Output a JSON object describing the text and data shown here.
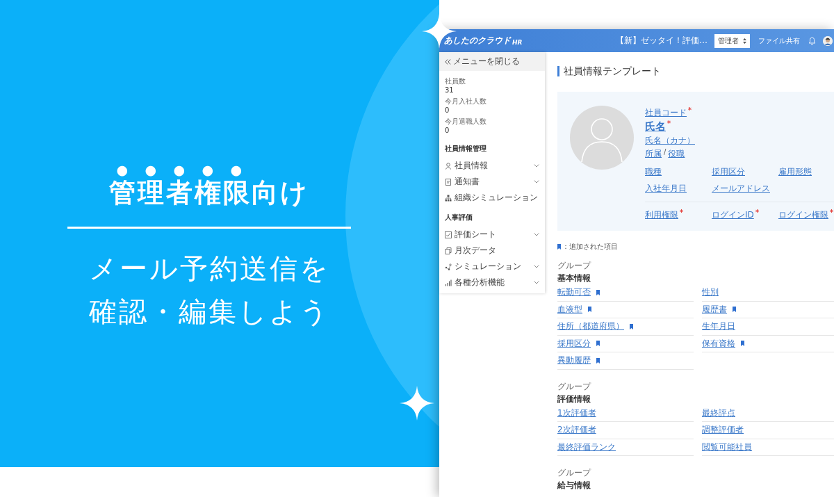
{
  "banner": {
    "heading_parts": [
      {
        "text": "管理者権限",
        "emphasis": true
      },
      {
        "text": "向け",
        "emphasis": false
      }
    ],
    "headline_lines": [
      "メール予約送信を",
      "確認・編集しよう"
    ]
  },
  "app": {
    "header": {
      "logo": "あしたのクラウド",
      "logo_suffix": "HR",
      "notice": "【新】ゼッタイ！評価…",
      "role_select": "管理者",
      "file_share": "ファイル共有"
    },
    "sidebar": {
      "collapse": "メニューを閉じる",
      "stats": [
        {
          "label": "社員数",
          "value": "31"
        },
        {
          "label": "今月入社人数",
          "value": "0"
        },
        {
          "label": "今月退職人数",
          "value": "0"
        }
      ],
      "sections": [
        {
          "title": "社員情報管理",
          "items": [
            {
              "label": "社員情報",
              "kind": "person",
              "expandable": true
            },
            {
              "label": "通知書",
              "kind": "document",
              "expandable": true
            },
            {
              "label": "組織シミュレーション",
              "kind": "org",
              "expandable": false
            }
          ]
        },
        {
          "title": "人事評価",
          "items": [
            {
              "label": "評価シート",
              "kind": "check",
              "expandable": true
            },
            {
              "label": "月次データ",
              "kind": "copy",
              "expandable": false
            },
            {
              "label": "シミュレーション",
              "kind": "nodes",
              "expandable": true
            },
            {
              "label": "各種分析機能",
              "kind": "bars",
              "expandable": true
            }
          ]
        }
      ]
    },
    "main": {
      "title": "社員情報テンプレート",
      "profile": {
        "code": {
          "label": "社員コード",
          "required": true
        },
        "name": {
          "label": "氏名",
          "required": true
        },
        "kana": "氏名（カナ）",
        "affiliation": "所属",
        "separator": "/",
        "position": "役職",
        "grid": [
          "職種",
          "採用区分",
          "雇用形態",
          "入社年月日",
          "メールアドレス"
        ],
        "access": [
          {
            "label": "利用権限",
            "required": true
          },
          {
            "label": "ログインID",
            "required": true
          },
          {
            "label": "ログイン権限",
            "required": true
          }
        ]
      },
      "legend": "：追加された項目",
      "groups": [
        {
          "label": "グループ",
          "title": "基本情報",
          "fields": [
            {
              "label": "転勤可否",
              "added": true
            },
            {
              "label": "性別",
              "added": false
            },
            {
              "label": "血液型",
              "added": true
            },
            {
              "label": "履歴書",
              "added": true
            },
            {
              "label": "住所（都道府県）",
              "added": true
            },
            {
              "label": "生年月日",
              "added": false
            },
            {
              "label": "採用区分",
              "added": true
            },
            {
              "label": "保有資格",
              "added": true
            },
            {
              "label": "異動履歴",
              "added": true
            }
          ]
        },
        {
          "label": "グループ",
          "title": "評価情報",
          "fields": [
            {
              "label": "1次評価者",
              "added": false
            },
            {
              "label": "最終評点",
              "added": false
            },
            {
              "label": "2次評価者",
              "added": false
            },
            {
              "label": "調整評価者",
              "added": false
            },
            {
              "label": "最終評価ランク",
              "added": false
            },
            {
              "label": "閲覧可能社員",
              "added": false
            }
          ]
        },
        {
          "label": "グループ",
          "title": "給与情報"
        }
      ]
    }
  }
}
